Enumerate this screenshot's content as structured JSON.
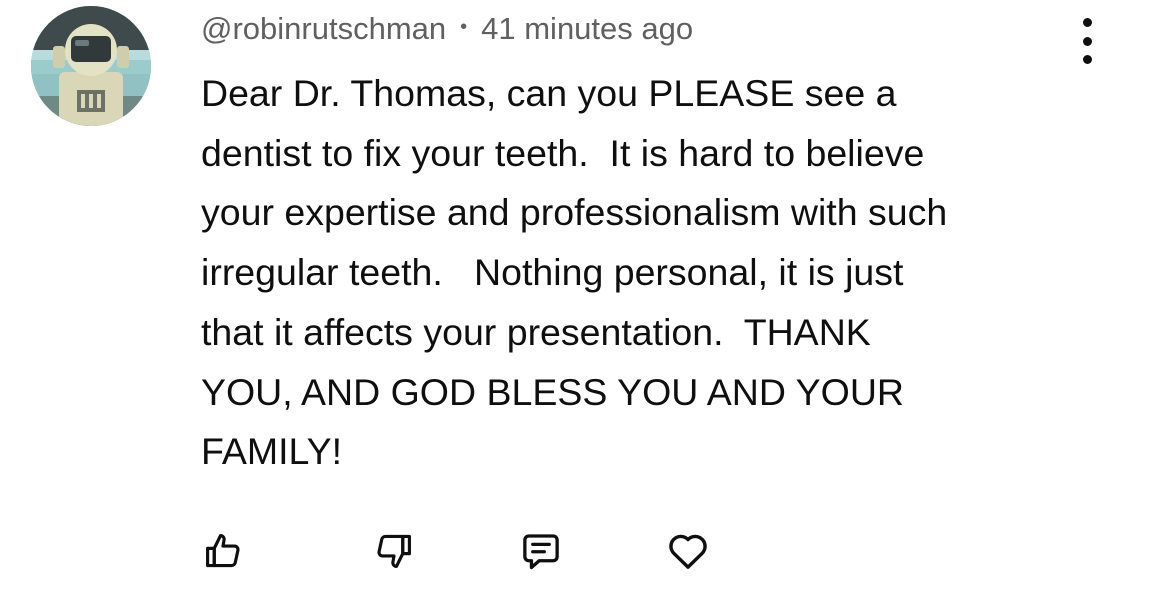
{
  "comment": {
    "author": "@robinrutschman",
    "separator": "•",
    "timestamp": "41 minutes ago",
    "text_lines": [
      "Dear Dr. Thomas, can you PLEASE see a",
      "dentist to fix your teeth.  It is hard to believe",
      "your expertise and professionalism with such",
      "irregular teeth.   Nothing personal, it is just",
      "that it affects your presentation.  THANK",
      "YOU, AND GOD BLESS YOU AND YOUR",
      "FAMILY!"
    ],
    "avatar_icon": "astronaut-avatar",
    "menu_icon": "more-vertical-icon",
    "actions": [
      {
        "name": "like",
        "icon": "thumbs-up-icon"
      },
      {
        "name": "dislike",
        "icon": "thumbs-down-icon"
      },
      {
        "name": "reply",
        "icon": "comment-icon"
      },
      {
        "name": "love",
        "icon": "heart-icon"
      }
    ]
  },
  "colors": {
    "background": "#ffffff",
    "text": "#0f0f0f",
    "meta_text": "#606060"
  }
}
